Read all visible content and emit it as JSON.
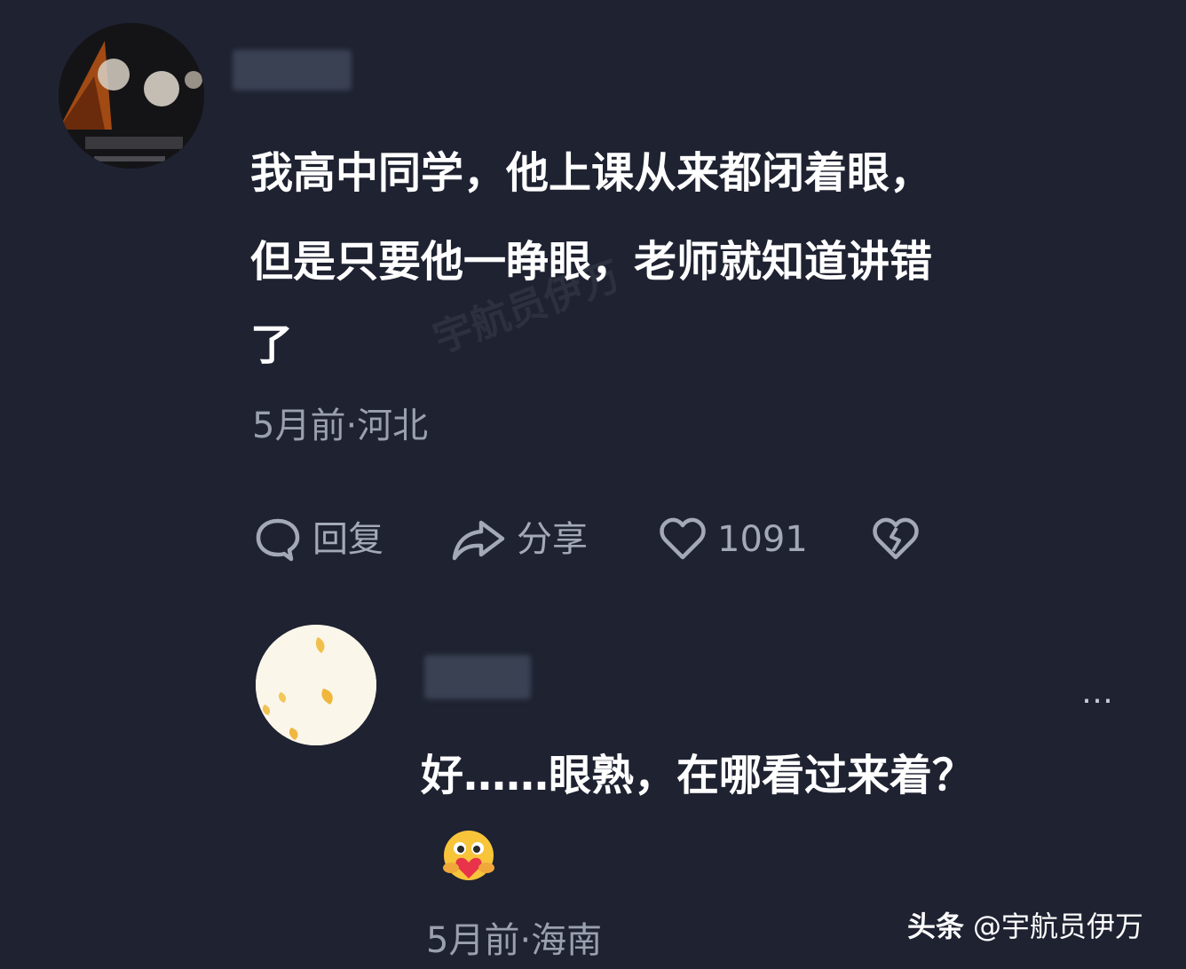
{
  "comment": {
    "avatar_icon": "avatar-photo-icon",
    "text_lines": [
      "我高中同学，他上课从来都闭着眼，",
      "但是只要他一睁眼，老师就知道讲错",
      "了"
    ],
    "meta": "5月前·河北",
    "actions": {
      "reply_label": "回复",
      "share_label": "分享",
      "like_count": "1091",
      "reply_icon": "comment-bubble-icon",
      "share_icon": "share-arrow-icon",
      "like_icon": "heart-icon",
      "dislike_icon": "broken-heart-icon"
    }
  },
  "reply": {
    "avatar_icon": "avatar-flower-icon",
    "more_label": "…",
    "text": "好……眼熟，在哪看过来着？",
    "emoji_icon": "hug-heart-emoji-icon",
    "meta": "5月前·海南"
  },
  "watermark": "宇航员伊万",
  "brand": {
    "logo": "头条",
    "handle": "@宇航员伊万"
  },
  "colors": {
    "background": "#1e2231",
    "text": "#ffffff",
    "muted": "#9aa0b0",
    "icon": "#a3a9b8"
  }
}
